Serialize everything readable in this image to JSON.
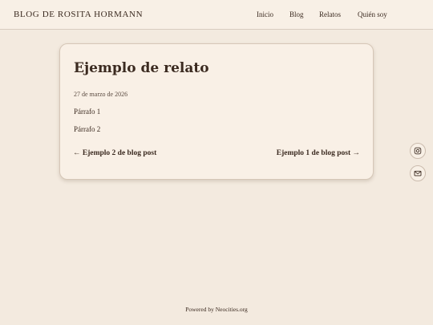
{
  "header": {
    "site_title": "BLOG DE ROSITA HORMANN",
    "nav": [
      {
        "label": "Inicio"
      },
      {
        "label": "Blog"
      },
      {
        "label": "Relatos"
      },
      {
        "label": "Quién soy"
      }
    ]
  },
  "post": {
    "title": "Ejemplo de relato",
    "date": "27 de marzo de 2026",
    "paragraphs": [
      "Párrafo 1",
      "Párrafo 2"
    ],
    "prev_label": "← Ejemplo 2 de blog post",
    "next_label": "Ejemplo 1 de blog post →"
  },
  "social": {
    "icons": [
      "instagram-icon",
      "mail-icon"
    ]
  },
  "footer": {
    "text": "Powered by Neocities.org"
  }
}
